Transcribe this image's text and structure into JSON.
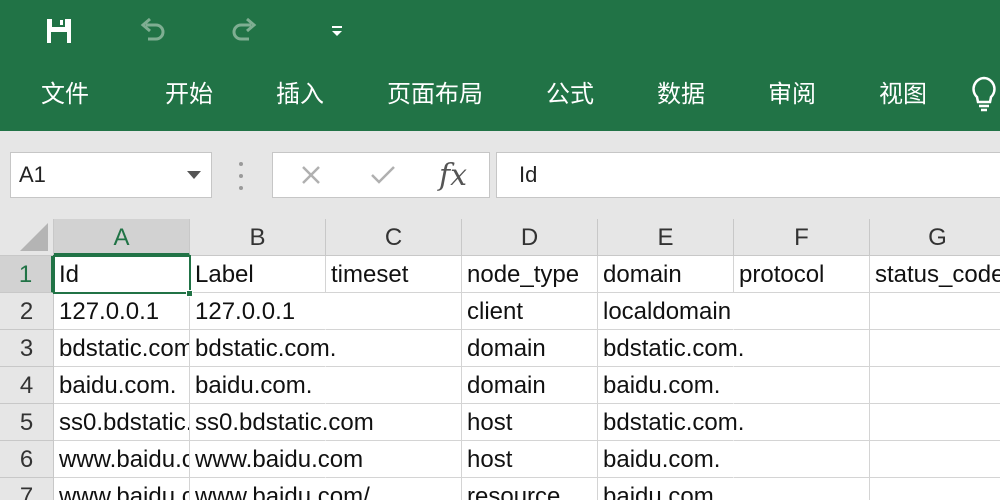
{
  "quick_access": {
    "save_icon": "save-icon",
    "undo_icon": "undo-icon",
    "redo_icon": "redo-icon",
    "customize_icon": "customize-qat-icon"
  },
  "menu_tabs": [
    "文件",
    "开始",
    "插入",
    "页面布局",
    "公式",
    "数据",
    "审阅",
    "视图"
  ],
  "tell_me_icon": "lightbulb-icon",
  "name_box": {
    "value": "A1"
  },
  "formula_bar": {
    "cancel_icon": "cancel-icon",
    "enter_icon": "enter-icon",
    "function_label": "fx",
    "value": "Id"
  },
  "sheet": {
    "columns": [
      "A",
      "B",
      "C",
      "D",
      "E",
      "F",
      "G"
    ],
    "active_column": "A",
    "active_row": "1",
    "rows": [
      {
        "num": "1",
        "cells": [
          "Id",
          "Label",
          "timeset",
          "node_type",
          "domain",
          "protocol",
          "status_code"
        ]
      },
      {
        "num": "2",
        "cells": [
          "127.0.0.1",
          "127.0.0.1",
          "",
          "client",
          "localdomain",
          "",
          ""
        ]
      },
      {
        "num": "3",
        "cells": [
          "bdstatic.com.",
          "bdstatic.com.",
          "",
          "domain",
          "bdstatic.com.",
          "",
          ""
        ]
      },
      {
        "num": "4",
        "cells": [
          "baidu.com.",
          "baidu.com.",
          "",
          "domain",
          "baidu.com.",
          "",
          ""
        ]
      },
      {
        "num": "5",
        "cells": [
          "ss0.bdstatic.com",
          "ss0.bdstatic.com",
          "",
          "host",
          "bdstatic.com.",
          "",
          ""
        ]
      },
      {
        "num": "6",
        "cells": [
          "www.baidu.com",
          "www.baidu.com",
          "",
          "host",
          "baidu.com.",
          "",
          ""
        ]
      },
      {
        "num": "7",
        "cells": [
          "www.baidu.com/",
          "www.baidu.com/",
          "",
          "resource",
          "baidu.com.",
          "",
          ""
        ]
      }
    ]
  },
  "colors": {
    "ribbon": "#217346",
    "header_bg": "#e6e6e6",
    "active_header_bg": "#d2d2d2",
    "grid_line": "#d4d4d4"
  }
}
